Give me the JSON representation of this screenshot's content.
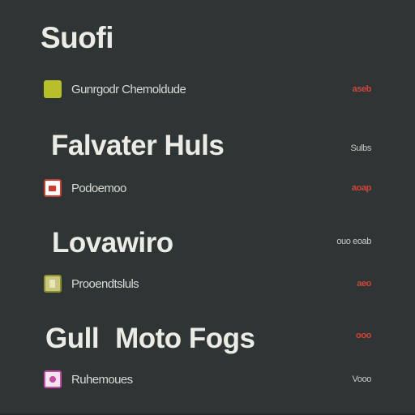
{
  "app": {
    "title": "Suofi"
  },
  "sections": [
    {
      "heading": "",
      "side_meta": "",
      "rows": [
        {
          "label": "Gunrgodr Chemoldude",
          "meta": "aseb",
          "meta_color": "red",
          "icon": "olive-square-icon"
        }
      ]
    },
    {
      "heading": "Falvater Huls",
      "side_meta": "Sulbs",
      "rows": [
        {
          "label": "Podoemoo",
          "meta": "aoap",
          "meta_color": "red",
          "icon": "red-image-icon"
        }
      ]
    },
    {
      "heading": "Lovawiro",
      "side_meta": "ouo eoab",
      "rows": [
        {
          "label": "Prooendtsluls",
          "meta": "aeo",
          "meta_color": "red",
          "icon": "document-icon"
        }
      ]
    },
    {
      "heading_part1": "Gull",
      "heading_part2": "Moto Fogs",
      "side_meta": "ooo",
      "rows": [
        {
          "label": "Ruhemoues",
          "meta": "Vooo",
          "meta_color": "grey",
          "icon": "pink-app-icon"
        }
      ]
    }
  ],
  "colors": {
    "background": "#2f3435",
    "text": "#ecece6",
    "accent_red": "#d0453a",
    "icon_olive": "#b7c02a"
  }
}
